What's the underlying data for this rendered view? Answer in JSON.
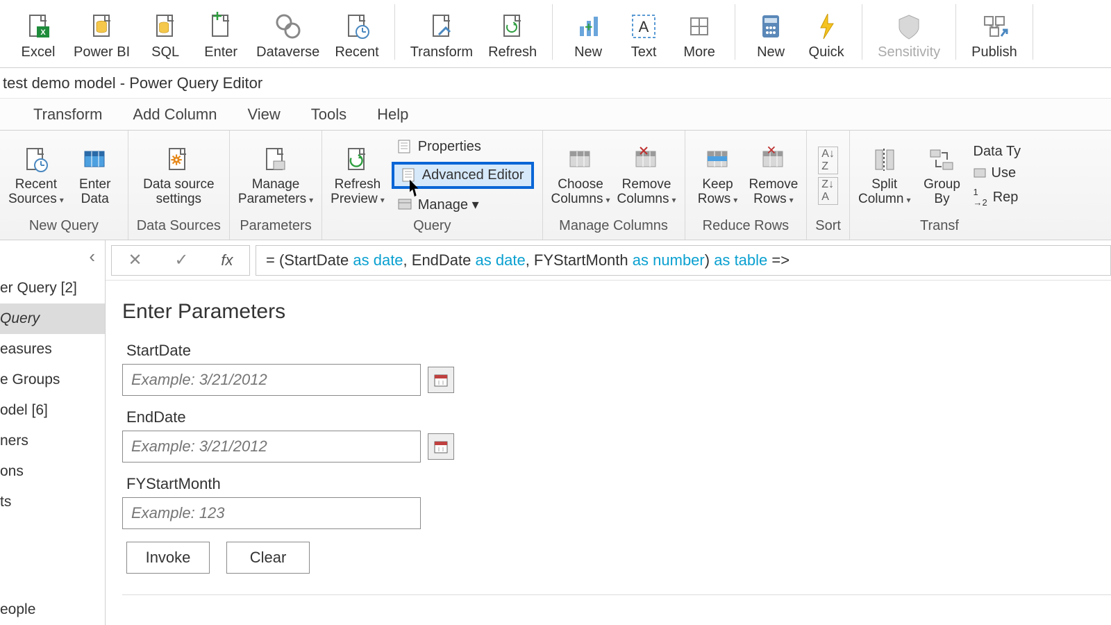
{
  "top_ribbon": {
    "excel": "Excel",
    "powerbi": "Power BI",
    "sql": "SQL",
    "enter": "Enter",
    "dataverse": "Dataverse",
    "recent": "Recent",
    "transform": "Transform",
    "refresh": "Refresh",
    "new": "New",
    "text": "Text",
    "more": "More",
    "new2": "New",
    "quick": "Quick",
    "sensitivity": "Sensitivity",
    "publish": "Publish"
  },
  "title": "test demo model - Power Query Editor",
  "tabs": {
    "transform": "Transform",
    "add_column": "Add Column",
    "view": "View",
    "tools": "Tools",
    "help": "Help"
  },
  "ribbon2": {
    "recent_sources": "Recent\nSources",
    "enter_data": "Enter\nData",
    "data_source": "Data source\nsettings",
    "manage_params": "Manage\nParameters",
    "refresh_preview": "Refresh\nPreview",
    "properties": "Properties",
    "advanced_editor": "Advanced Editor",
    "manage": "Manage",
    "choose_cols": "Choose\nColumns",
    "remove_cols": "Remove\nColumns",
    "keep_rows": "Keep\nRows",
    "remove_rows": "Remove\nRows",
    "split_col": "Split\nColumn",
    "group_by": "Group\nBy",
    "data_type": "Data Ty",
    "use": "Use",
    "rep": "Rep",
    "g_newquery": "New Query",
    "g_datasources": "Data Sources",
    "g_params": "Parameters",
    "g_query": "Query",
    "g_managecols": "Manage Columns",
    "g_reducerows": "Reduce Rows",
    "g_sort": "Sort",
    "g_transform": "Transf"
  },
  "side": {
    "header": "er Query [2]",
    "sel": "Query",
    "m1": "easures",
    "m2": "e Groups",
    "m3": "odel [6]",
    "m4": "ners",
    "m5": "ons",
    "m6": "ts",
    "m7": "eople"
  },
  "formula": {
    "eq": "= (StartDate ",
    "as1": "as",
    "sp1": " ",
    "date1": "date",
    "c1": ", EndDate ",
    "as2": "as",
    "sp2": " ",
    "date2": "date",
    "c2": ", FYStartMonth ",
    "as3": "as",
    "sp3": " ",
    "num": "number",
    "c3": ") ",
    "as4": "as",
    "sp4": " ",
    "tbl": "table",
    "arrow": " =>"
  },
  "params": {
    "title": "Enter Parameters",
    "f1_label": "StartDate",
    "f1_ph": "Example: 3/21/2012",
    "f2_label": "EndDate",
    "f2_ph": "Example: 3/21/2012",
    "f3_label": "FYStartMonth",
    "f3_ph": "Example: 123",
    "invoke": "Invoke",
    "clear": "Clear"
  }
}
